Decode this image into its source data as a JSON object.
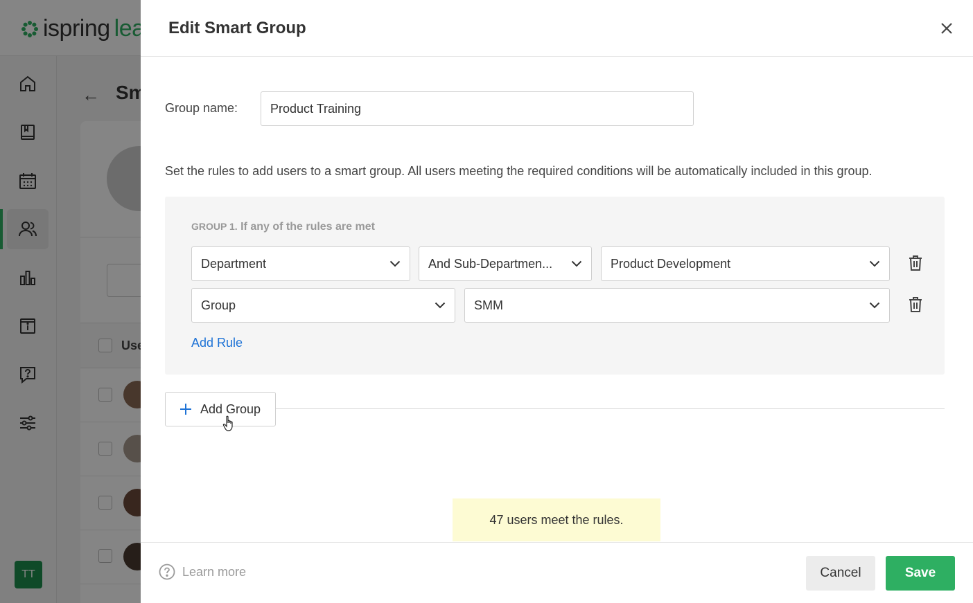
{
  "app": {
    "logo_text": "ispring",
    "logo_suffix": "lea",
    "page_title": "Sm",
    "table_column": "Use",
    "user_initials": "TT"
  },
  "nav": {
    "items": [
      "home-icon",
      "book-icon",
      "calendar-icon",
      "users-icon",
      "chart-icon",
      "info-icon",
      "help-chat-icon",
      "settings-sliders-icon"
    ],
    "active_item": "users-icon"
  },
  "modal": {
    "title": "Edit Smart Group",
    "group_name_label": "Group name:",
    "group_name_value": "Product Training",
    "instructions": "Set the rules to add users to a smart group. All users meeting the required conditions will be automatically included in this group.",
    "group": {
      "caption_prefix": "GROUP 1.",
      "caption_text": "If any of the rules are met",
      "rules": [
        {
          "field": "Department",
          "operator": "And Sub-Departmen...",
          "value": "Product Development"
        },
        {
          "field": "Group",
          "value": "SMM"
        }
      ],
      "add_rule_label": "Add Rule"
    },
    "add_group_label": "Add Group",
    "result_notice": "47 users meet the rules.",
    "learn_more_label": "Learn more",
    "cancel_label": "Cancel",
    "save_label": "Save"
  },
  "colors": {
    "brand_green": "#2eaf62",
    "link_blue": "#1f73d6",
    "notice_bg": "#fdfbd3"
  }
}
